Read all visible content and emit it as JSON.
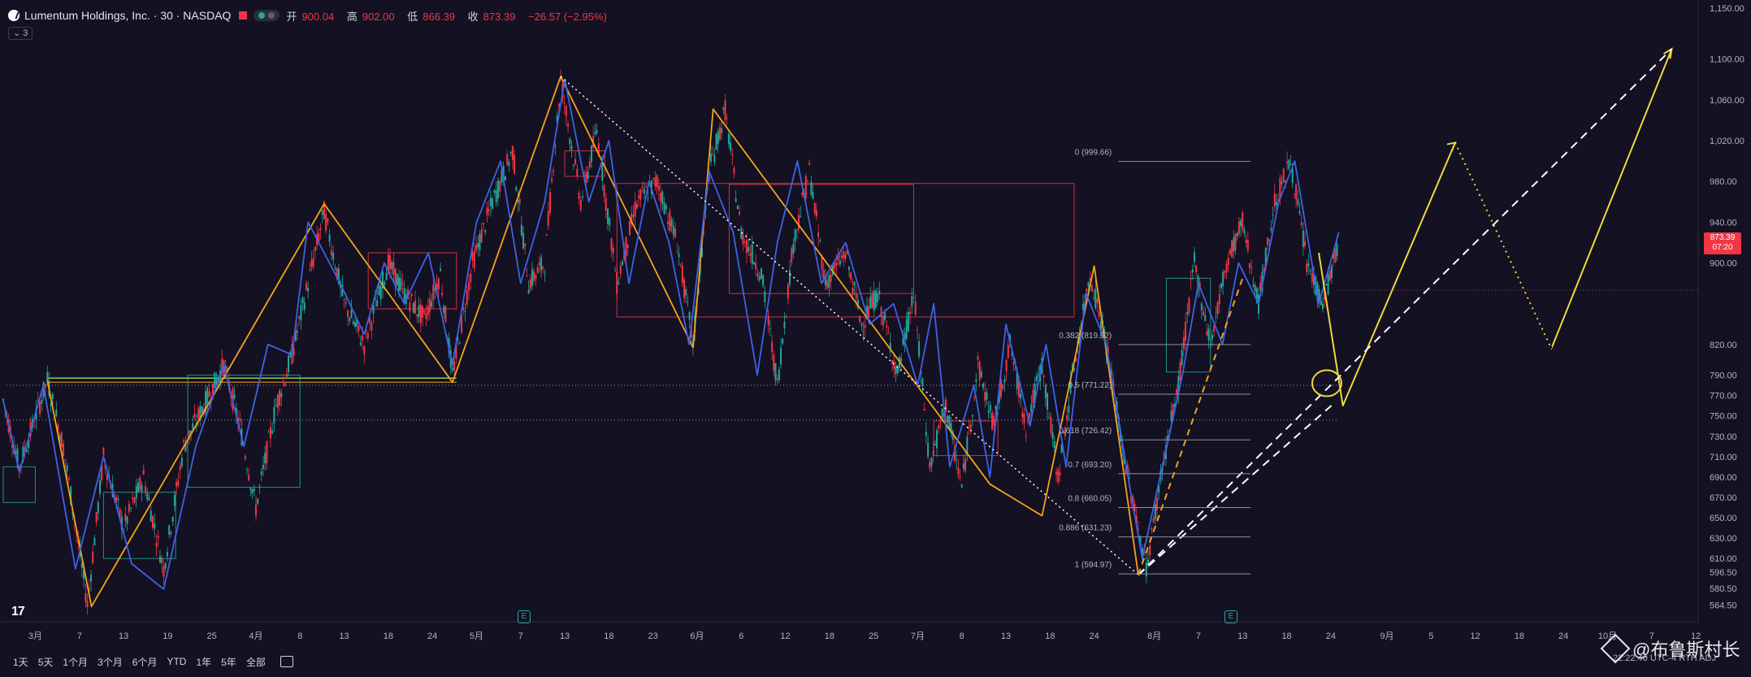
{
  "header": {
    "symbol": "Lumentum Holdings, Inc. · 30 · NASDAQ",
    "open_label": "开",
    "open_value": "900.04",
    "high_label": "高",
    "high_value": "902.00",
    "low_label": "低",
    "low_value": "866.39",
    "close_label": "收",
    "close_value": "873.39",
    "change": "−26.57 (−2.95%)",
    "indicator_count": "3"
  },
  "price_tag": {
    "price": "873.39",
    "countdown": "07:20"
  },
  "timeframes": [
    "1天",
    "5天",
    "1个月",
    "3个月",
    "6个月",
    "YTD",
    "1年",
    "5年",
    "全部"
  ],
  "watermark": "@布鲁斯村长",
  "clock": "22:22:40 UTC-4  RTH  ADJ",
  "tv_logo": "17",
  "earnings_badge": "E",
  "colors": {
    "background": "#131122",
    "up": "#26a69a",
    "down": "#f23645",
    "zigzag_orange": "#f7a21a",
    "zigzag_blue": "#3d62e6",
    "projection_yellow": "#f2d73c",
    "fib_line": "#8d8f99",
    "green_box": "#26a69a",
    "red_box": "#f23645",
    "lime_line": "#8bd04c"
  },
  "chart_data": {
    "type": "candlestick",
    "title": "Lumentum Holdings, Inc. · 30 · NASDAQ",
    "xlabel": "",
    "ylabel": "",
    "ylim": [
      548,
      1158
    ],
    "y_scale": "linear",
    "grid": false,
    "legend": "none",
    "y_ticks": [
      1150,
      1100,
      1060,
      1020,
      980,
      940,
      900,
      820,
      790,
      770,
      750,
      730,
      710,
      690,
      670,
      650,
      630,
      610,
      596.5,
      580.5,
      564.5
    ],
    "y_tick_labels": [
      "1,150.00",
      "1,100.00",
      "1,060.00",
      "1,020.00",
      "980.00",
      "940.00",
      "900.00",
      "820.00",
      "790.00",
      "770.00",
      "750.00",
      "730.00",
      "710.00",
      "690.00",
      "670.00",
      "650.00",
      "630.00",
      "610.00",
      "596.50",
      "580.50",
      "564.50"
    ],
    "x_ticks": [
      {
        "t": 8,
        "label": "3月"
      },
      {
        "t": 19,
        "label": "7"
      },
      {
        "t": 30,
        "label": "13"
      },
      {
        "t": 41,
        "label": "19"
      },
      {
        "t": 52,
        "label": "25"
      },
      {
        "t": 63,
        "label": "4月"
      },
      {
        "t": 74,
        "label": "8"
      },
      {
        "t": 85,
        "label": "13"
      },
      {
        "t": 96,
        "label": "18"
      },
      {
        "t": 107,
        "label": "24"
      },
      {
        "t": 118,
        "label": "5月"
      },
      {
        "t": 129,
        "label": "7"
      },
      {
        "t": 140,
        "label": "13"
      },
      {
        "t": 151,
        "label": "18"
      },
      {
        "t": 162,
        "label": "23"
      },
      {
        "t": 173,
        "label": "6月"
      },
      {
        "t": 184,
        "label": "6"
      },
      {
        "t": 195,
        "label": "12"
      },
      {
        "t": 206,
        "label": "18"
      },
      {
        "t": 217,
        "label": "25"
      },
      {
        "t": 228,
        "label": "7月"
      },
      {
        "t": 239,
        "label": "8"
      },
      {
        "t": 250,
        "label": "13"
      },
      {
        "t": 261,
        "label": "18"
      },
      {
        "t": 272,
        "label": "24"
      },
      {
        "t": 287,
        "label": "8月"
      },
      {
        "t": 298,
        "label": "7"
      },
      {
        "t": 309,
        "label": "13"
      },
      {
        "t": 320,
        "label": "18"
      },
      {
        "t": 331,
        "label": "24"
      },
      {
        "t": 345,
        "label": "9月"
      },
      {
        "t": 356,
        "label": "5"
      },
      {
        "t": 367,
        "label": "12"
      },
      {
        "t": 378,
        "label": "18"
      },
      {
        "t": 389,
        "label": "24"
      },
      {
        "t": 400,
        "label": "10月"
      },
      {
        "t": 411,
        "label": "7"
      },
      {
        "t": 422,
        "label": "12"
      }
    ],
    "series": [
      {
        "type": "candles",
        "anchors": [
          [
            0,
            765
          ],
          [
            4,
            700
          ],
          [
            11,
            785
          ],
          [
            15,
            720
          ],
          [
            21,
            565
          ],
          [
            25,
            710
          ],
          [
            30,
            640
          ],
          [
            35,
            690
          ],
          [
            40,
            600
          ],
          [
            45,
            720
          ],
          [
            50,
            760
          ],
          [
            55,
            800
          ],
          [
            59,
            740
          ],
          [
            63,
            660
          ],
          [
            68,
            760
          ],
          [
            72,
            810
          ],
          [
            76,
            880
          ],
          [
            80,
            950
          ],
          [
            85,
            860
          ],
          [
            90,
            820
          ],
          [
            96,
            900
          ],
          [
            100,
            870
          ],
          [
            105,
            845
          ],
          [
            109,
            890
          ],
          [
            112,
            790
          ],
          [
            117,
            900
          ],
          [
            122,
            960
          ],
          [
            127,
            1010
          ],
          [
            131,
            880
          ],
          [
            135,
            900
          ],
          [
            139,
            1080
          ],
          [
            144,
            960
          ],
          [
            148,
            1030
          ],
          [
            153,
            880
          ],
          [
            158,
            960
          ],
          [
            163,
            980
          ],
          [
            168,
            920
          ],
          [
            172,
            820
          ],
          [
            176,
            990
          ],
          [
            180,
            1050
          ],
          [
            184,
            930
          ],
          [
            189,
            890
          ],
          [
            193,
            780
          ],
          [
            197,
            920
          ],
          [
            201,
            990
          ],
          [
            205,
            880
          ],
          [
            210,
            910
          ],
          [
            214,
            840
          ],
          [
            218,
            870
          ],
          [
            223,
            790
          ],
          [
            227,
            870
          ],
          [
            231,
            700
          ],
          [
            235,
            760
          ],
          [
            239,
            680
          ],
          [
            243,
            800
          ],
          [
            247,
            740
          ],
          [
            251,
            820
          ],
          [
            255,
            740
          ],
          [
            259,
            800
          ],
          [
            263,
            690
          ],
          [
            267,
            800
          ],
          [
            271,
            890
          ],
          [
            275,
            820
          ],
          [
            279,
            720
          ],
          [
            283,
            640
          ],
          [
            285,
            600
          ],
          [
            289,
            700
          ],
          [
            293,
            780
          ],
          [
            297,
            900
          ],
          [
            301,
            820
          ],
          [
            305,
            900
          ],
          [
            309,
            940
          ],
          [
            313,
            860
          ],
          [
            317,
            960
          ],
          [
            321,
            1000
          ],
          [
            325,
            900
          ],
          [
            329,
            860
          ],
          [
            333,
            920
          ]
        ]
      },
      {
        "type": "zigzag",
        "name": "",
        "color": "#f7a21a",
        "points": [
          [
            11,
            785
          ],
          [
            22,
            563
          ],
          [
            80,
            958
          ],
          [
            112,
            783
          ],
          [
            139,
            1083
          ],
          [
            172,
            817
          ],
          [
            177,
            1051
          ],
          [
            246,
            683
          ],
          [
            259,
            652
          ],
          [
            272,
            897
          ],
          [
            283,
            594
          ]
        ]
      },
      {
        "type": "zigzag",
        "name": "",
        "color": "#3d62e6",
        "points": [
          [
            0,
            765
          ],
          [
            4,
            695
          ],
          [
            10,
            780
          ],
          [
            18,
            600
          ],
          [
            25,
            710
          ],
          [
            32,
            605
          ],
          [
            40,
            580
          ],
          [
            48,
            720
          ],
          [
            55,
            800
          ],
          [
            60,
            720
          ],
          [
            66,
            820
          ],
          [
            72,
            810
          ],
          [
            76,
            940
          ],
          [
            84,
            880
          ],
          [
            90,
            830
          ],
          [
            95,
            900
          ],
          [
            100,
            860
          ],
          [
            106,
            910
          ],
          [
            112,
            800
          ],
          [
            118,
            940
          ],
          [
            124,
            1000
          ],
          [
            129,
            880
          ],
          [
            135,
            960
          ],
          [
            140,
            1080
          ],
          [
            146,
            960
          ],
          [
            151,
            1020
          ],
          [
            156,
            880
          ],
          [
            161,
            980
          ],
          [
            166,
            920
          ],
          [
            171,
            820
          ],
          [
            176,
            990
          ],
          [
            182,
            930
          ],
          [
            188,
            790
          ],
          [
            193,
            920
          ],
          [
            198,
            1000
          ],
          [
            204,
            880
          ],
          [
            210,
            920
          ],
          [
            216,
            840
          ],
          [
            222,
            860
          ],
          [
            228,
            780
          ],
          [
            232,
            860
          ],
          [
            236,
            700
          ],
          [
            242,
            780
          ],
          [
            246,
            690
          ],
          [
            250,
            840
          ],
          [
            256,
            740
          ],
          [
            260,
            820
          ],
          [
            265,
            700
          ],
          [
            270,
            870
          ],
          [
            275,
            820
          ],
          [
            280,
            700
          ],
          [
            284,
            610
          ],
          [
            289,
            700
          ],
          [
            294,
            790
          ],
          [
            298,
            880
          ],
          [
            304,
            820
          ],
          [
            308,
            900
          ],
          [
            313,
            860
          ],
          [
            318,
            960
          ],
          [
            322,
            1000
          ],
          [
            328,
            860
          ],
          [
            333,
            930
          ]
        ]
      },
      {
        "type": "projection",
        "name": "",
        "color": "#f2d73c",
        "points": [
          [
            328,
            910
          ],
          [
            334,
            760
          ],
          [
            362,
            1018
          ],
          [
            386,
            816
          ],
          [
            416,
            1110
          ]
        ]
      }
    ],
    "fib": {
      "levels": [
        {
          "ratio": "0",
          "value": 999.66,
          "label": "0 (999.66)"
        },
        {
          "ratio": "0.5",
          "value": 771.22,
          "label": "0.5 (771.22)"
        },
        {
          "ratio": "0.618",
          "value": 726.42,
          "label": "0.618 (726.42)"
        },
        {
          "ratio": "0.7",
          "value": 693.2,
          "label": "0.7 (693.20)"
        },
        {
          "ratio": "0.8",
          "value": 660.05,
          "label": "0.8 (660.05)"
        },
        {
          "ratio": "0.886",
          "value": 631.23,
          "label": "0.886 (631.23)"
        },
        {
          "ratio": "1",
          "value": 594.97,
          "label": "1 (594.97)"
        }
      ],
      "extra_label": "0.382 (819.92)",
      "extra_value": 819.92
    },
    "boxes": [
      {
        "t0": 0,
        "t1": 8,
        "v0": 665,
        "v1": 700,
        "color": "#26a69a"
      },
      {
        "t0": 25,
        "t1": 43,
        "v0": 610,
        "v1": 675,
        "color": "#26a69a"
      },
      {
        "t0": 46,
        "t1": 74,
        "v0": 680,
        "v1": 790,
        "color": "#26a69a"
      },
      {
        "t0": 91,
        "t1": 113,
        "v0": 855,
        "v1": 910,
        "color": "#f23645"
      },
      {
        "t0": 140,
        "t1": 150,
        "v0": 985,
        "v1": 1010,
        "color": "#f23645"
      },
      {
        "t0": 153,
        "t1": 267,
        "v0": 847,
        "v1": 978,
        "color": "#f23645"
      },
      {
        "t0": 181,
        "t1": 227,
        "v0": 870,
        "v1": 977,
        "color": "#f23645"
      },
      {
        "t0": 232,
        "t1": 248,
        "v0": 711,
        "v1": 745,
        "color": "#f23645"
      },
      {
        "t0": 290,
        "t1": 301,
        "v0": 793,
        "v1": 885,
        "color": "#26a69a"
      }
    ],
    "annotations": [
      {
        "type": "dotted_white",
        "from": [
          139,
          1083
        ],
        "to": [
          283,
          594
        ]
      },
      {
        "type": "dashed_white",
        "from": [
          283,
          594
        ],
        "to": [
          416,
          1110
        ]
      },
      {
        "type": "dashed_white",
        "from": [
          283,
          594
        ],
        "to": [
          332,
          763
        ]
      },
      {
        "type": "dashed_orange",
        "from": [
          283,
          594
        ],
        "to": [
          309,
          885
        ]
      },
      {
        "type": "ellipse_yellow",
        "t": 330,
        "v": 782
      },
      {
        "type": "horizontal_dotted",
        "v": 780
      },
      {
        "type": "horizontal_dotted",
        "v": 746
      },
      {
        "type": "lime_range",
        "t0": 11,
        "t1": 113,
        "v0": 783,
        "v1": 787
      }
    ]
  }
}
